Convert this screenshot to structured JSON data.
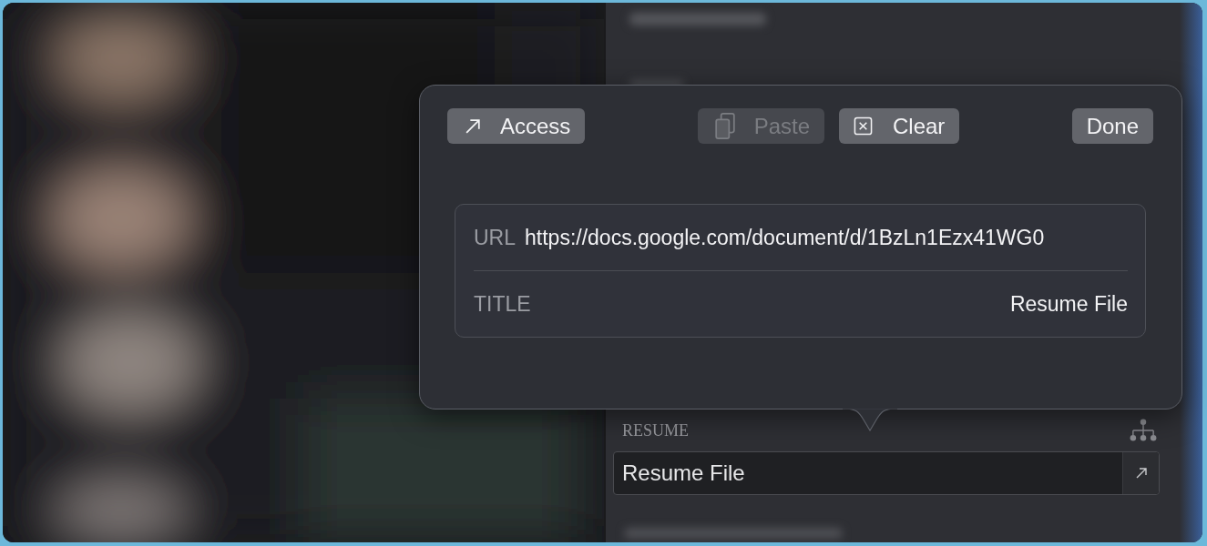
{
  "popover": {
    "buttons": [
      {
        "kind": "access",
        "label": "Access",
        "disabled": false
      },
      {
        "kind": "paste",
        "label": "Paste",
        "disabled": true
      },
      {
        "kind": "clear",
        "label": "Clear",
        "disabled": false
      },
      {
        "kind": "done",
        "label": "Done",
        "disabled": false
      }
    ],
    "fields": [
      {
        "kind": "url",
        "label": "URL",
        "value": "https://docs.google.com/document/d/1BzLn1Ezx41WG0"
      },
      {
        "kind": "title",
        "label": "TITLE",
        "value": "Resume File"
      }
    ]
  },
  "section": {
    "label": "RESUME",
    "field_value": "Resume File"
  }
}
